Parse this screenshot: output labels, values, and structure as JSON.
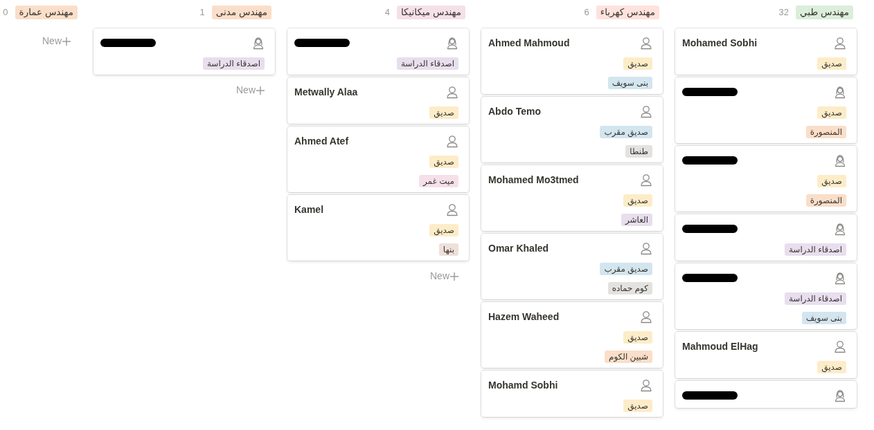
{
  "columns": [
    {
      "label": "مهندس طبي",
      "color": "#dbeddb",
      "count": "32",
      "cards": [
        {
          "redacted": false,
          "name": "Mohamed Sobhi",
          "kind": "male",
          "tags": [
            {
              "label": "صديق",
              "color": "#fdecc8"
            }
          ]
        },
        {
          "redacted": true,
          "kind": "female",
          "tags": [
            {
              "label": "صديق",
              "color": "#fdecc8"
            },
            {
              "label": "المنصورة",
              "color": "#fadec9"
            }
          ]
        },
        {
          "redacted": true,
          "kind": "female",
          "tags": [
            {
              "label": "صديق",
              "color": "#fdecc8"
            },
            {
              "label": "المنصورة",
              "color": "#fadec9"
            }
          ]
        },
        {
          "redacted": true,
          "kind": "female",
          "tags": [
            {
              "label": "اصدقاء الدراسة",
              "color": "#e8deee"
            }
          ]
        },
        {
          "redacted": true,
          "kind": "female",
          "tags": [
            {
              "label": "اصدقاء الدراسة",
              "color": "#e8deee"
            },
            {
              "label": "بنى سويف",
              "color": "#d3e5ef"
            }
          ]
        },
        {
          "redacted": false,
          "name": "Mahmoud ElHag",
          "kind": "male",
          "tags": [
            {
              "label": "صديق",
              "color": "#fdecc8"
            }
          ]
        },
        {
          "redacted": true,
          "kind": "female"
        }
      ]
    },
    {
      "label": "مهندس كهرباء",
      "color": "#ffe2dd",
      "count": "6",
      "cards": [
        {
          "redacted": false,
          "name": "Ahmed Mahmoud",
          "kind": "male",
          "tags": [
            {
              "label": "صديق",
              "color": "#fdecc8"
            },
            {
              "label": "بنى سويف",
              "color": "#d3e5ef"
            }
          ]
        },
        {
          "redacted": false,
          "name": "Abdo Temo",
          "kind": "male",
          "tags": [
            {
              "label": "صديق مقرب",
              "color": "#d3e5ef"
            },
            {
              "label": "طنطا",
              "color": "#e3e2e0"
            }
          ]
        },
        {
          "redacted": false,
          "name": "Mohamed Mo3tmed",
          "kind": "male",
          "tags": [
            {
              "label": "صديق",
              "color": "#fdecc8"
            },
            {
              "label": "العاشر",
              "color": "#e8deee"
            }
          ]
        },
        {
          "redacted": false,
          "name": "Omar Khaled",
          "kind": "male",
          "tags": [
            {
              "label": "صديق مقرب",
              "color": "#d3e5ef"
            },
            {
              "label": "كوم حماده",
              "color": "#e3e2e0"
            }
          ]
        },
        {
          "redacted": false,
          "name": "Hazem Waheed",
          "kind": "male",
          "tags": [
            {
              "label": "صديق",
              "color": "#fdecc8"
            },
            {
              "label": "شبين الكوم",
              "color": "#fadec9"
            }
          ]
        },
        {
          "redacted": false,
          "name": "Mohamd Sobhi",
          "kind": "male",
          "tags": [
            {
              "label": "صديق",
              "color": "#fdecc8"
            }
          ]
        }
      ]
    },
    {
      "label": "مهندس ميكانيكا",
      "color": "#f5e0e9",
      "count": "4",
      "new_label": "New",
      "cards": [
        {
          "redacted": true,
          "kind": "female",
          "tags": [
            {
              "label": "اصدقاء الدراسة",
              "color": "#e8deee"
            }
          ]
        },
        {
          "redacted": false,
          "name": "Metwally Alaa",
          "kind": "male",
          "tags": [
            {
              "label": "صديق",
              "color": "#fdecc8"
            }
          ]
        },
        {
          "redacted": false,
          "name": "Ahmed Atef",
          "kind": "male",
          "tags": [
            {
              "label": "صديق",
              "color": "#fdecc8"
            },
            {
              "label": "ميت غمر",
              "color": "#f5e0e9"
            }
          ]
        },
        {
          "redacted": false,
          "name": "Kamel",
          "kind": "male",
          "tags": [
            {
              "label": "صديق",
              "color": "#fdecc8"
            },
            {
              "label": "بنها",
              "color": "#eee0da"
            }
          ]
        }
      ]
    },
    {
      "label": "مهندس مدنى",
      "color": "#fadec9",
      "count": "1",
      "new_label": "New",
      "cards": [
        {
          "redacted": true,
          "kind": "female",
          "tags": [
            {
              "label": "اصدقاء الدراسة",
              "color": "#e8deee"
            }
          ]
        }
      ]
    },
    {
      "label": "مهندس عمارة",
      "color": "#fadec9",
      "count": "0",
      "new_label": "New"
    }
  ]
}
